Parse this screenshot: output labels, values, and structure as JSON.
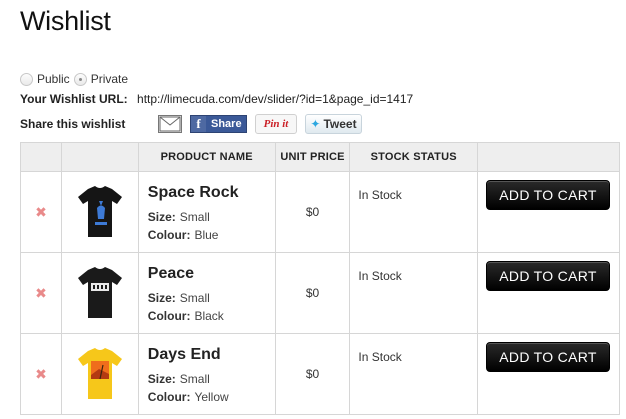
{
  "page": {
    "title": "Wishlist"
  },
  "privacy": {
    "options": [
      {
        "label": "Public",
        "checked": false
      },
      {
        "label": "Private",
        "checked": true
      }
    ]
  },
  "url": {
    "label": "Your Wishlist URL:",
    "value": "http://limecuda.com/dev/slider/?id=1&page_id=1417"
  },
  "share": {
    "label": "Share this wishlist",
    "buttons": {
      "email_icon": "envelope-icon",
      "facebook": "Share",
      "pinterest": "Pin it",
      "twitter": "Tweet"
    }
  },
  "table": {
    "headers": [
      "",
      "",
      "PRODUCT NAME",
      "UNIT PRICE",
      "STOCK STATUS",
      ""
    ],
    "size_label": "Size:",
    "colour_label": "Colour:",
    "add_label": "ADD TO CART",
    "remove_icon": "remove-x-icon",
    "rows": [
      {
        "name": "Space Rock",
        "size": "Small",
        "colour": "Blue",
        "price": "$0",
        "stock": "In Stock",
        "shirt_color": "#151515",
        "print_color": "#3d7ad6"
      },
      {
        "name": "Peace",
        "size": "Small",
        "colour": "Black",
        "price": "$0",
        "stock": "In Stock",
        "shirt_color": "#1a1a1a",
        "print_color": "#e8e8e8"
      },
      {
        "name": "Days End",
        "size": "Small",
        "colour": "Yellow",
        "price": "$0",
        "stock": "In Stock",
        "shirt_color": "#f6c71a",
        "print_color": "#ef6d1c"
      }
    ]
  }
}
